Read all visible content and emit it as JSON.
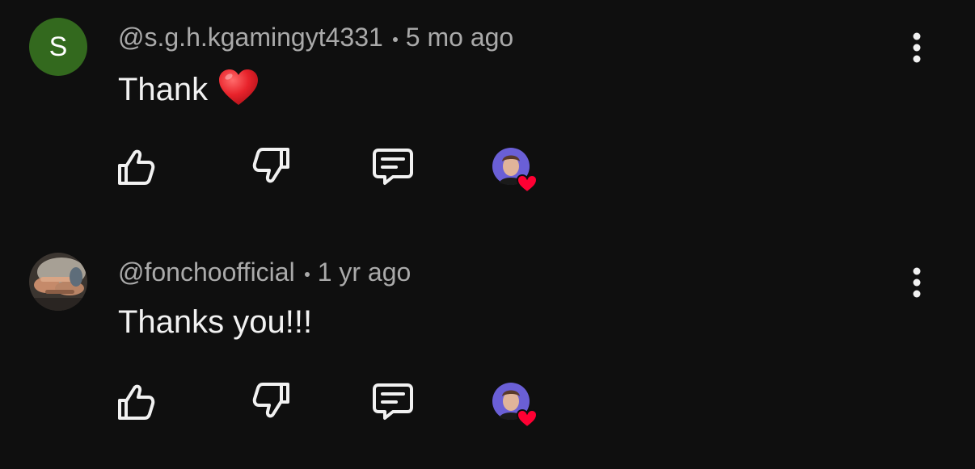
{
  "comments": [
    {
      "author": "@s.g.h.kgamingyt4331",
      "time": "5 mo ago",
      "avatar_letter": "S",
      "avatar_color": "#33691e",
      "text": "Thank",
      "emoji": "red-heart"
    },
    {
      "author": "@fonchoofficial",
      "time": "1 yr ago",
      "avatar": "photo-avatar",
      "text": "Thanks you!!!"
    }
  ],
  "colors": {
    "background": "#0f0f0f",
    "primary_text": "#f1f1f1",
    "secondary_text": "#aaaaaa",
    "creator_heart": "#ff0033",
    "creator_avatar_bg": "#6a5fd6"
  },
  "icons": [
    "like-icon",
    "dislike-icon",
    "reply-icon",
    "creator-heart-icon",
    "more-options-icon"
  ]
}
